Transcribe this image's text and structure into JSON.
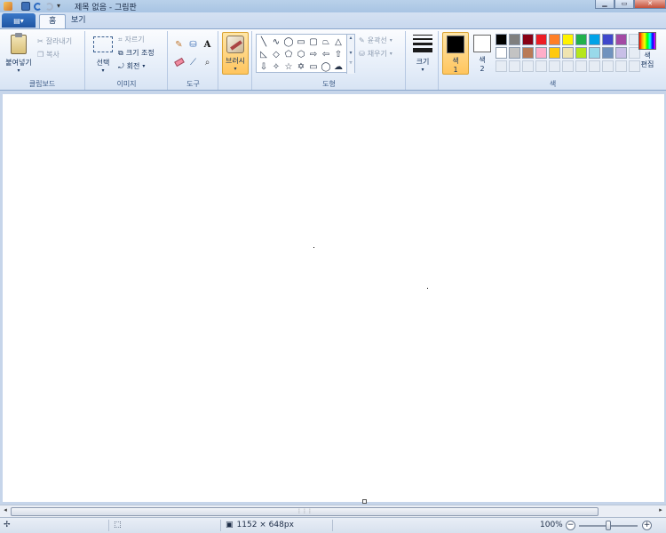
{
  "window": {
    "title": "제목 없음 - 그림판",
    "minimize_icon": "minimize-icon",
    "maximize_icon": "maximize-icon",
    "close_icon": "close-icon"
  },
  "tabs": {
    "file_label": "▤▾",
    "home": "홈",
    "view": "보기"
  },
  "clipboard": {
    "paste": "붙여넣기",
    "cut": "잘라내기",
    "copy": "복사",
    "group": "클립보드"
  },
  "image": {
    "select": "선택",
    "crop": "자르기",
    "resize": "크기 조정",
    "rotate": "회전",
    "group": "이미지"
  },
  "tools": {
    "group": "도구",
    "text_glyph": "A"
  },
  "brushes": {
    "label": "브러시"
  },
  "shapes": {
    "outline": "윤곽선",
    "fill": "채우기",
    "group": "도형"
  },
  "size": {
    "label": "크기"
  },
  "colors": {
    "color1_line1": "색",
    "color1_line2": "1",
    "color2_line1": "색",
    "color2_line2": "2",
    "edit_line1": "색",
    "edit_line2": "편집",
    "group": "색",
    "color1_value": "#000000",
    "color2_value": "#ffffff",
    "palette": [
      "#000000",
      "#7f7f7f",
      "#880015",
      "#ed1c24",
      "#ff7f27",
      "#fff200",
      "#22b14c",
      "#00a2e8",
      "#3f48cc",
      "#a349a4",
      "#ffffff",
      "#c3c3c3",
      "#b97a57",
      "#ffaec9",
      "#ffc90e",
      "#efe4b0",
      "#b5e61d",
      "#99d9ea",
      "#7092be",
      "#c8bfe7"
    ]
  },
  "status": {
    "canvas_size": "1152 × 648px",
    "zoom": "100%"
  }
}
